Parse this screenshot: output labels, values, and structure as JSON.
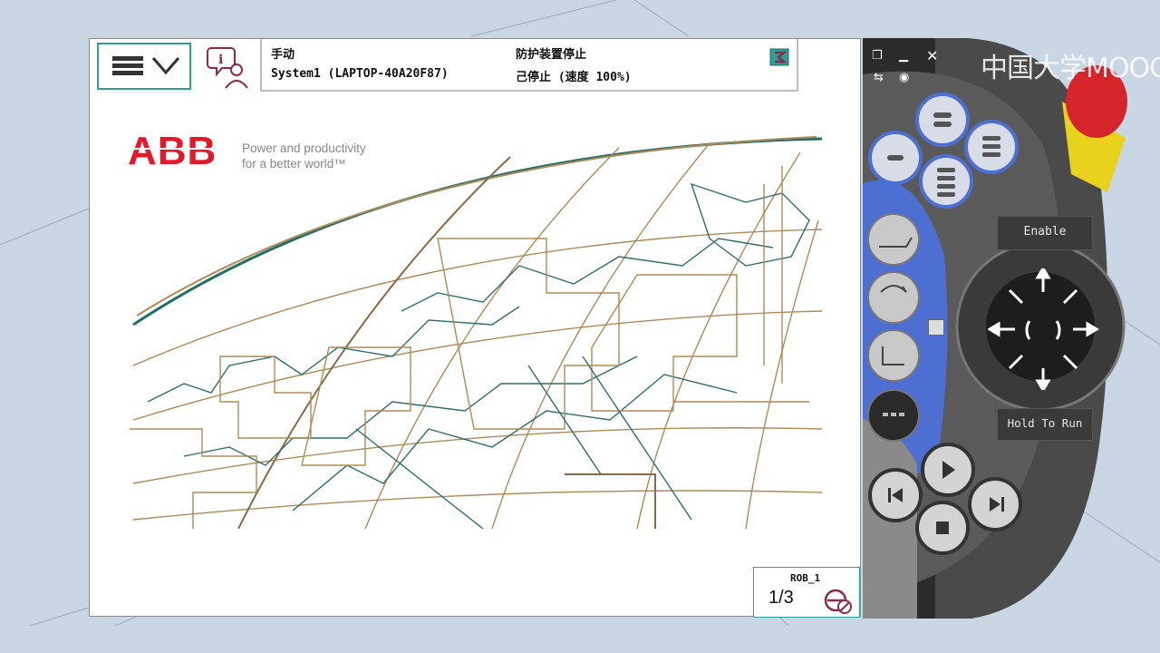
{
  "screen": {
    "status": {
      "mode": "手动",
      "system": "System1 (LAPTOP-40A20F87)",
      "state": "防护装置停止",
      "run_state": "己停止 (速度 100%)"
    },
    "brand": {
      "logo_text": "ABB",
      "tagline_line1": "Power and productivity",
      "tagline_line2": "for a better world™"
    },
    "task": {
      "robot": "ROB_1",
      "fraction": "1/3"
    }
  },
  "device": {
    "watermark": "中国大学MOOC",
    "enable_label": "Enable",
    "hold_label": "Hold To Run"
  },
  "colors": {
    "accent": "#2e9f97",
    "logo_red": "#e4182b",
    "flexpendant_blue": "#4d6fd1",
    "emergency_red": "#d6252a"
  },
  "icons": [
    "menu-icon",
    "chevron-down-icon",
    "info-person-icon",
    "close-icon",
    "task-icon",
    "minimize-icon",
    "maximize-icon",
    "camera-icon",
    "swap-icon",
    "play-icon",
    "stop-icon",
    "step-back-icon",
    "step-forward-icon",
    "joystick-icon"
  ]
}
